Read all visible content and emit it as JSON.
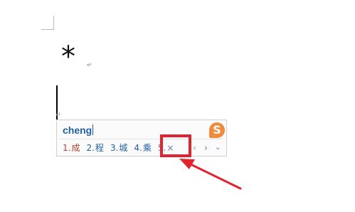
{
  "document": {
    "symbol": "*",
    "paragraph_mark": "↵"
  },
  "ime": {
    "input_text": "cheng",
    "logo_text": "S",
    "candidates": [
      {
        "num": "1.",
        "text": "成"
      },
      {
        "num": "2.",
        "text": "程"
      },
      {
        "num": "3.",
        "text": "城"
      },
      {
        "num": "4.",
        "text": "乘"
      },
      {
        "num": "5.",
        "text": "×"
      }
    ],
    "prev_glyph": "‹",
    "next_glyph": "›",
    "expand_glyph": "⌄"
  },
  "annotation": {
    "highlight_color": "#e0242f"
  },
  "colors": {
    "ime_text": "#1f5fa8",
    "ime_first_candidate": "#c0392b",
    "ime_logo": "#f08a3c"
  }
}
